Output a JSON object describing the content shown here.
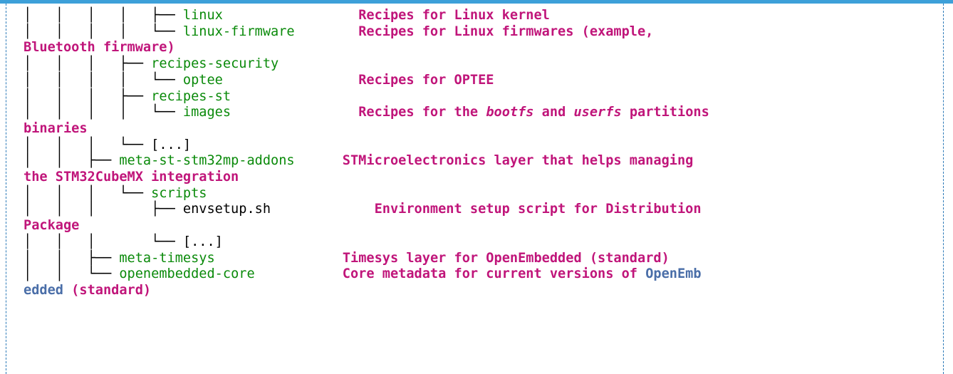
{
  "lines": [
    {
      "tree": "│   │   │   │   ├── ",
      "name": "linux",
      "pad": "                 ",
      "comment": "Recipes for Linux kernel"
    },
    {
      "tree": "│   │   │   │   └── ",
      "name": "linux-firmware",
      "pad": "        ",
      "comment": "Recipes for Linux firmwares (example,"
    },
    {
      "cont": "Bluetooth firmware)"
    },
    {
      "tree": "│   │   │   ├── ",
      "name": "recipes-security"
    },
    {
      "tree": "│   │   │   │   └── ",
      "name": "optee",
      "pad": "                 ",
      "comment": "Recipes for OPTEE"
    },
    {
      "tree": "│   │   │   ├── ",
      "name": "recipes-st"
    },
    {
      "tree": "│   │   │   │   └── ",
      "name": "images",
      "pad": "                ",
      "comment_parts": [
        "Recipes for the ",
        "bootfs",
        " and ",
        "userfs",
        " partitions"
      ]
    },
    {
      "cont": "binaries"
    },
    {
      "tree": "│   │   │   └── ",
      "plain": "[...]"
    },
    {
      "tree": "│   │   ├── ",
      "name": "meta-st-stm32mp-addons",
      "pad": "      ",
      "comment": "STMicroelectronics layer that helps managing"
    },
    {
      "cont": "the STM32CubeMX integration"
    },
    {
      "tree": "│   │   │   └── ",
      "name": "scripts"
    },
    {
      "tree": "│   │   │       ├── ",
      "file": "envsetup.sh",
      "pad": "             ",
      "comment": "Environment setup script for Distribution"
    },
    {
      "cont": "Package"
    },
    {
      "tree": "│   │   │       └── ",
      "plain": "[...]"
    },
    {
      "tree": "│   │   ├── ",
      "name": "meta-timesys",
      "pad": "                ",
      "comment": "Timesys layer for OpenEmbedded (standard)"
    },
    {
      "tree": "│   │   └── ",
      "name": "openembedded-core",
      "pad": "           ",
      "comment": "Core metadata for current versions of ",
      "link_a": "OpenEmb"
    },
    {
      "link_b": "edded",
      "cont_after": " (standard)"
    }
  ]
}
